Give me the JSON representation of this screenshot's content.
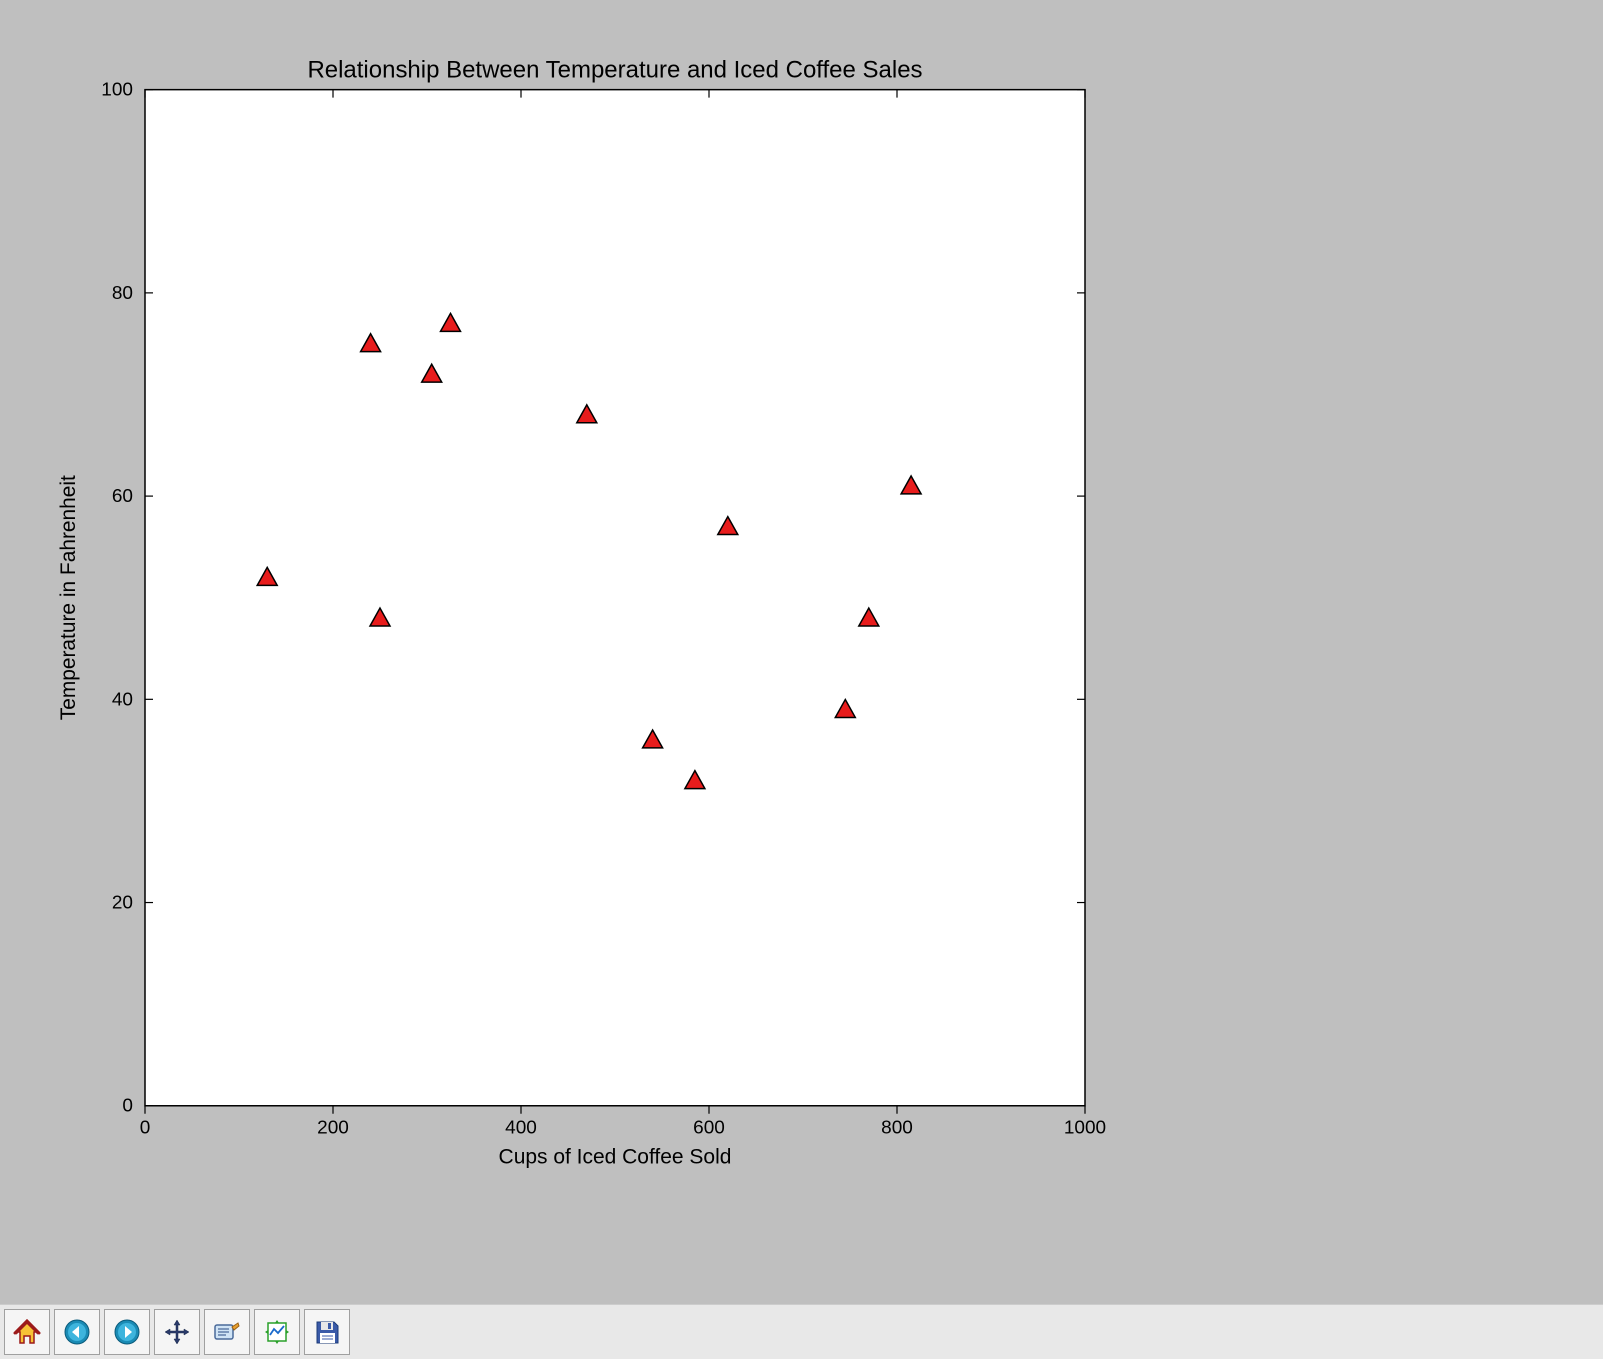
{
  "chart_data": {
    "type": "scatter",
    "title": "Relationship Between Temperature and Iced Coffee Sales",
    "xlabel": "Cups of Iced Coffee Sold",
    "ylabel": "Temperature in Fahrenheit",
    "xlim": [
      0,
      1000
    ],
    "ylim": [
      0,
      100
    ],
    "xticks": [
      0,
      200,
      400,
      600,
      800,
      1000
    ],
    "yticks": [
      0,
      20,
      40,
      60,
      80,
      100
    ],
    "points": [
      {
        "x": 130,
        "y": 52
      },
      {
        "x": 240,
        "y": 75
      },
      {
        "x": 250,
        "y": 48
      },
      {
        "x": 305,
        "y": 72
      },
      {
        "x": 325,
        "y": 77
      },
      {
        "x": 470,
        "y": 68
      },
      {
        "x": 540,
        "y": 36
      },
      {
        "x": 585,
        "y": 32
      },
      {
        "x": 620,
        "y": 57
      },
      {
        "x": 745,
        "y": 39
      },
      {
        "x": 770,
        "y": 48
      },
      {
        "x": 815,
        "y": 61
      }
    ],
    "marker": {
      "shape": "triangle",
      "fill": "#e81c1c",
      "stroke": "#000000"
    }
  },
  "toolbar": {
    "buttons": [
      {
        "name": "home-icon",
        "label": "Home"
      },
      {
        "name": "back-icon",
        "label": "Back"
      },
      {
        "name": "forward-icon",
        "label": "Forward"
      },
      {
        "name": "pan-icon",
        "label": "Pan"
      },
      {
        "name": "zoom-icon",
        "label": "Zoom"
      },
      {
        "name": "subplots-icon",
        "label": "Configure subplots"
      },
      {
        "name": "save-icon",
        "label": "Save"
      }
    ]
  }
}
